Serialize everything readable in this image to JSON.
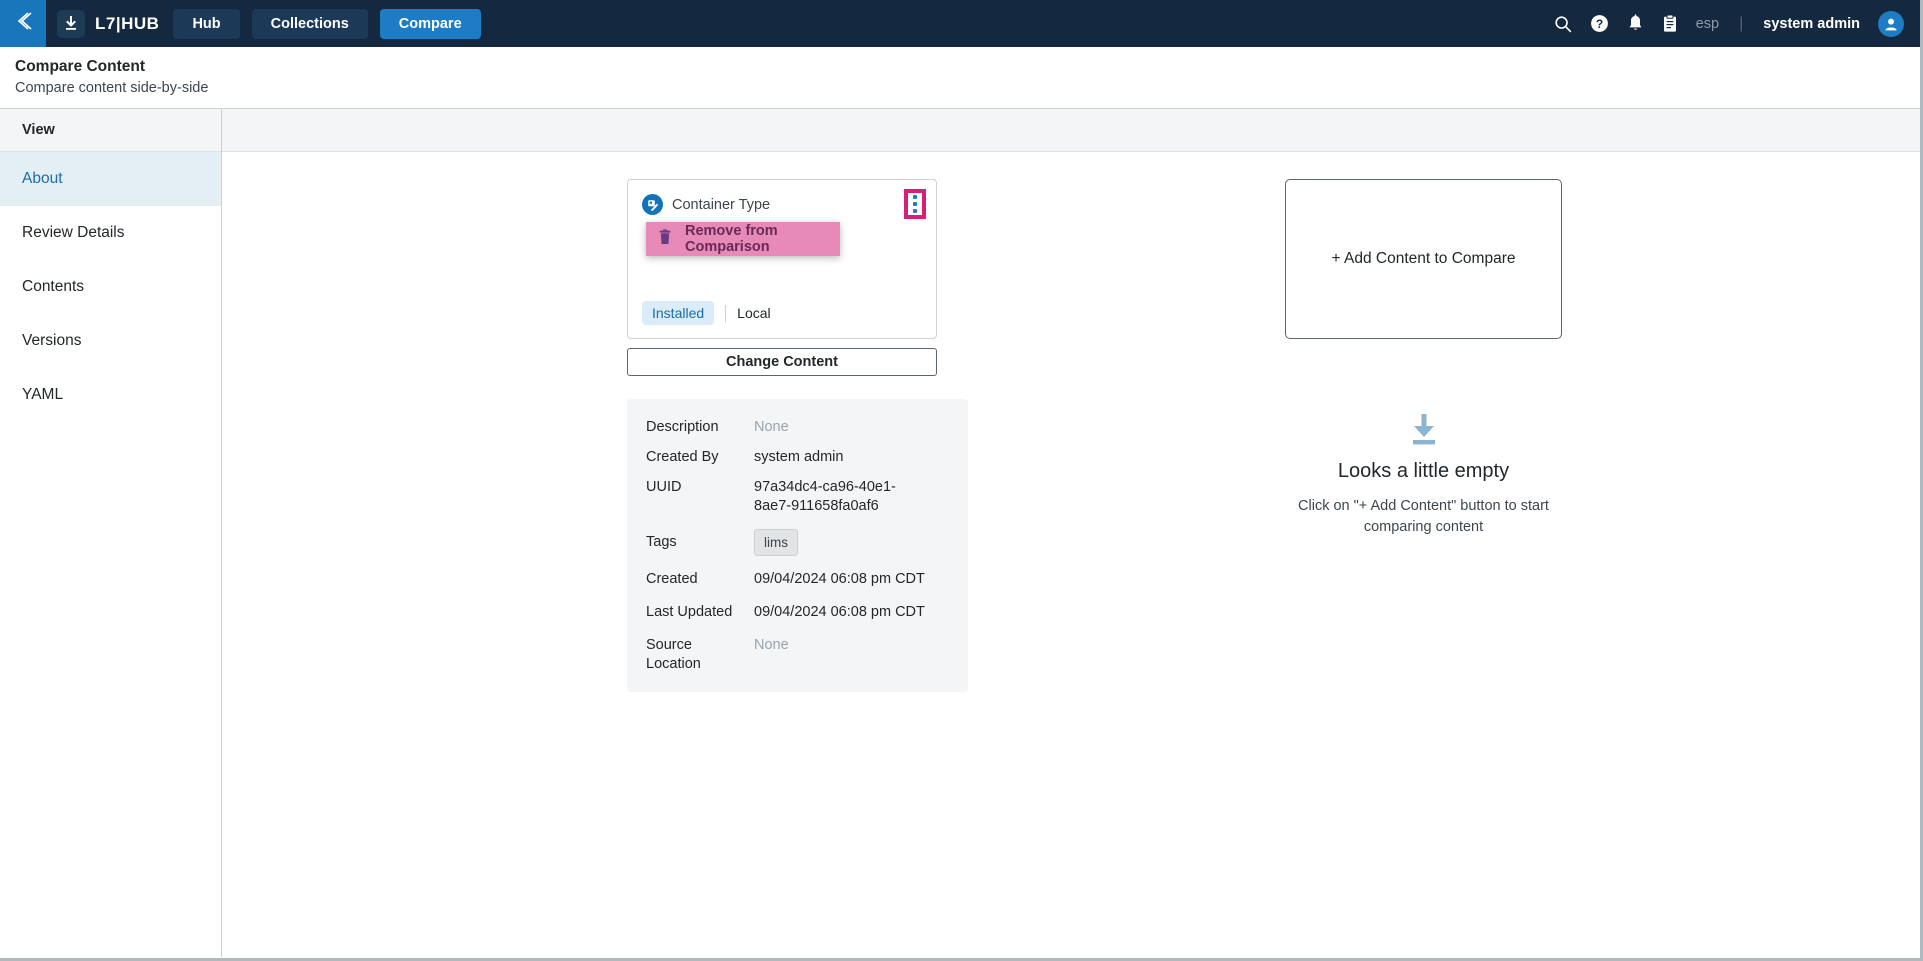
{
  "topbar": {
    "back_icon": "chevron-left-icon",
    "brand_icon": "download-icon",
    "brand": "L7|HUB",
    "tabs": [
      {
        "label": "Hub",
        "active": false
      },
      {
        "label": "Collections",
        "active": false
      },
      {
        "label": "Compare",
        "active": true
      }
    ],
    "icons": [
      "search-icon",
      "help-icon",
      "bell-icon",
      "clipboard-icon"
    ],
    "tenant": "esp",
    "separator": "|",
    "username": "system admin",
    "avatar_icon": "user-avatar-icon",
    "bg_color": "#14293f",
    "accent_color": "#1d7cc4"
  },
  "page": {
    "title": "Compare Content",
    "subtitle": "Compare content side-by-side"
  },
  "sidebar": {
    "header": "View",
    "items": [
      {
        "label": "About",
        "active": true
      },
      {
        "label": "Review Details",
        "active": false
      },
      {
        "label": "Contents",
        "active": false
      },
      {
        "label": "Versions",
        "active": false
      },
      {
        "label": "YAML",
        "active": false
      }
    ],
    "active_bg": "#e3eef5",
    "active_fg": "#1b6ca8"
  },
  "left_column": {
    "card": {
      "type_icon": "content-type-icon",
      "title": "Container Type",
      "kebab_icon": "kebab-menu-icon",
      "kebab_highlight_color": "#d61f77",
      "status_badge": "Installed",
      "source_label": "Local"
    },
    "menu": {
      "items": [
        {
          "icon": "trash-icon",
          "label": "Remove from Comparison",
          "highlighted": true
        }
      ],
      "highlight_color": "#e78ab8"
    },
    "change_button": "Change Content",
    "details": [
      {
        "label": "Description",
        "value": "None",
        "muted": true,
        "type": "text"
      },
      {
        "label": "Created By",
        "value": "system admin",
        "muted": false,
        "type": "text"
      },
      {
        "label": "UUID",
        "value": "97a34dc4-ca96-40e1-8ae7-911658fa0af6",
        "muted": false,
        "type": "text"
      },
      {
        "label": "Tags",
        "value": "lims",
        "muted": false,
        "type": "chip"
      },
      {
        "label": "Created",
        "value": "09/04/2024 06:08 pm CDT",
        "muted": false,
        "type": "text"
      },
      {
        "label": "Last Updated",
        "value": "09/04/2024 06:08 pm CDT",
        "muted": false,
        "type": "text"
      },
      {
        "label": "Source Location",
        "value": "None",
        "muted": true,
        "type": "text"
      }
    ]
  },
  "right_column": {
    "dropzone_label": "+ Add Content to Compare",
    "empty_icon": "download-arrow-icon",
    "empty_icon_color": "#8cb4d2",
    "empty_title": "Looks a little empty",
    "empty_desc": "Click on \"+ Add Content\" button to start comparing content"
  }
}
